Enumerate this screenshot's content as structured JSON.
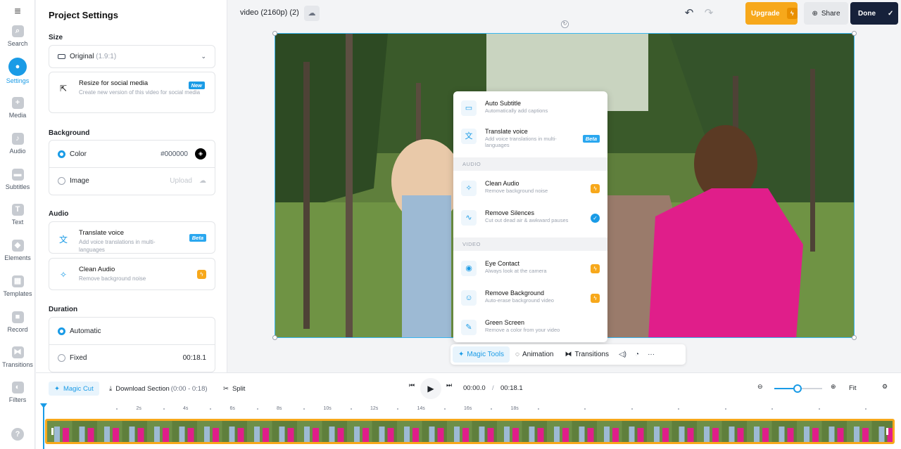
{
  "sidebar": {
    "menu_icon": "hamburger-icon",
    "items": [
      {
        "label": "Search",
        "icon": "search-icon",
        "glyph": "⌕"
      },
      {
        "label": "Settings",
        "icon": "gear-icon",
        "glyph": "●"
      },
      {
        "label": "Media",
        "icon": "plus-icon",
        "glyph": "+"
      },
      {
        "label": "Audio",
        "icon": "music-note-icon",
        "glyph": "♪"
      },
      {
        "label": "Subtitles",
        "icon": "subtitles-icon",
        "glyph": "▬"
      },
      {
        "label": "Text",
        "icon": "text-icon",
        "glyph": "T"
      },
      {
        "label": "Elements",
        "icon": "elements-icon",
        "glyph": "◆"
      },
      {
        "label": "Templates",
        "icon": "templates-icon",
        "glyph": "▦"
      },
      {
        "label": "Record",
        "icon": "record-icon",
        "glyph": "■"
      },
      {
        "label": "Transitions",
        "icon": "transitions-icon",
        "glyph": "⧓"
      },
      {
        "label": "Filters",
        "icon": "filters-icon",
        "glyph": "◐"
      }
    ],
    "help_glyph": "?"
  },
  "settings": {
    "title": "Project Settings",
    "size": {
      "label": "Size",
      "dropdown_value": "Original",
      "dropdown_ratio": "(1.9:1)",
      "resize_title": "Resize for social media",
      "resize_sub": "Create new version of this video for social media",
      "new_badge": "New"
    },
    "background": {
      "label": "Background",
      "color_label": "Color",
      "color_value": "#000000",
      "image_label": "Image",
      "upload_label": "Upload"
    },
    "audio": {
      "label": "Audio",
      "translate_title": "Translate voice",
      "translate_sub": "Add voice translations in multi-languages",
      "beta_badge": "Beta",
      "clean_title": "Clean Audio",
      "clean_sub": "Remove background noise"
    },
    "duration": {
      "label": "Duration",
      "automatic_label": "Automatic",
      "fixed_label": "Fixed",
      "fixed_value": "00:18.1"
    }
  },
  "topbar": {
    "video_title": "video (2160p) (2)",
    "upgrade_label": "Upgrade",
    "share_label": "Share",
    "done_label": "Done"
  },
  "magic_menu": {
    "items_top": [
      {
        "title": "Auto Subtitle",
        "sub": "Automatically add captions",
        "icon": "subtitle-icon"
      },
      {
        "title": "Translate voice",
        "sub": "Add voice translations in multi-languages",
        "icon": "translate-icon",
        "badge": "Beta"
      }
    ],
    "audio_header": "AUDIO",
    "items_audio": [
      {
        "title": "Clean Audio",
        "sub": "Remove background noise",
        "icon": "sparkle-icon"
      },
      {
        "title": "Remove Silences",
        "sub": "Cut out dead air & awkward pauses",
        "icon": "waveform-icon"
      }
    ],
    "video_header": "VIDEO",
    "items_video": [
      {
        "title": "Eye Contact",
        "sub": "Always look at the camera",
        "icon": "eye-icon"
      },
      {
        "title": "Remove Background",
        "sub": "Auto-erase background video",
        "icon": "person-icon"
      },
      {
        "title": "Green Screen",
        "sub": "Remove a color from your video",
        "icon": "eyedropper-icon"
      }
    ]
  },
  "floating_toolbar": {
    "magic_tools": "Magic Tools",
    "animation": "Animation",
    "transitions": "Transitions"
  },
  "timeline": {
    "magic_cut": "Magic Cut",
    "download_section": "Download Section",
    "download_range": "(0:00 - 0:18)",
    "split": "Split",
    "current_time": "00:00.0",
    "separator": "/",
    "total_time": "00:18.1",
    "fit_label": "Fit",
    "zoom_level": 0.48,
    "ruler_labels": [
      "2s",
      "4s",
      "6s",
      "8s",
      "10s",
      "12s",
      "14s",
      "16s",
      "18s"
    ]
  }
}
